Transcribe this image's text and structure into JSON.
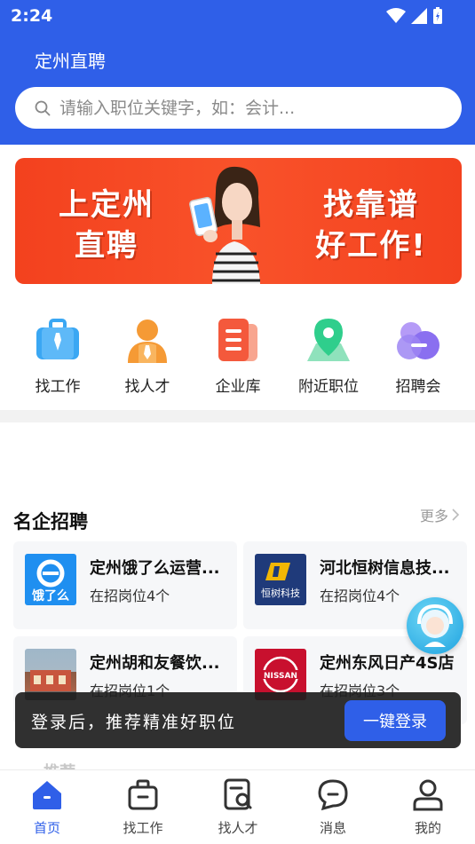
{
  "status_bar": {
    "time": "2:24"
  },
  "header": {
    "title": "定州直聘",
    "search_placeholder": "请输入职位关键字，如：会计..."
  },
  "banner": {
    "left_text_line1": "上定州",
    "left_text_line2": "直聘",
    "right_text_line1": "找靠谱",
    "right_text_line2": "好工作!"
  },
  "categories": [
    {
      "label": "找工作",
      "icon": "briefcase-icon",
      "color": "#3aa7f3"
    },
    {
      "label": "找人才",
      "icon": "person-icon",
      "color": "#f59a35"
    },
    {
      "label": "企业库",
      "icon": "building-icon",
      "color": "#f4593c"
    },
    {
      "label": "附近职位",
      "icon": "map-pin-icon",
      "color": "#2fce8c"
    },
    {
      "label": "招聘会",
      "icon": "group-icon",
      "color": "#8a6ff0"
    }
  ],
  "companies": {
    "title": "名企招聘",
    "more": "更多",
    "items": [
      {
        "name": "定州饿了么运营...",
        "count": "在招岗位4个",
        "logo_text": "饿了么"
      },
      {
        "name": "河北恒树信息技...",
        "count": "在招岗位4个",
        "logo_text": "恒树科技"
      },
      {
        "name": "定州胡和友餐饮...",
        "count": "在招岗位1个",
        "logo_text": ""
      },
      {
        "name": "定州东风日产4S店",
        "count": "在招岗位3个",
        "logo_text": "NISSAN"
      }
    ]
  },
  "toast": {
    "text": "登录后，推荐精准好职位",
    "button": "一键登录"
  },
  "peek": {
    "text": "· 推荐"
  },
  "tabbar": {
    "items": [
      {
        "label": "首页",
        "active": true
      },
      {
        "label": "找工作",
        "active": false
      },
      {
        "label": "找人才",
        "active": false
      },
      {
        "label": "消息",
        "active": false
      },
      {
        "label": "我的",
        "active": false
      }
    ]
  },
  "colors": {
    "brand": "#2f5fe8",
    "banner": "#f64a24"
  }
}
